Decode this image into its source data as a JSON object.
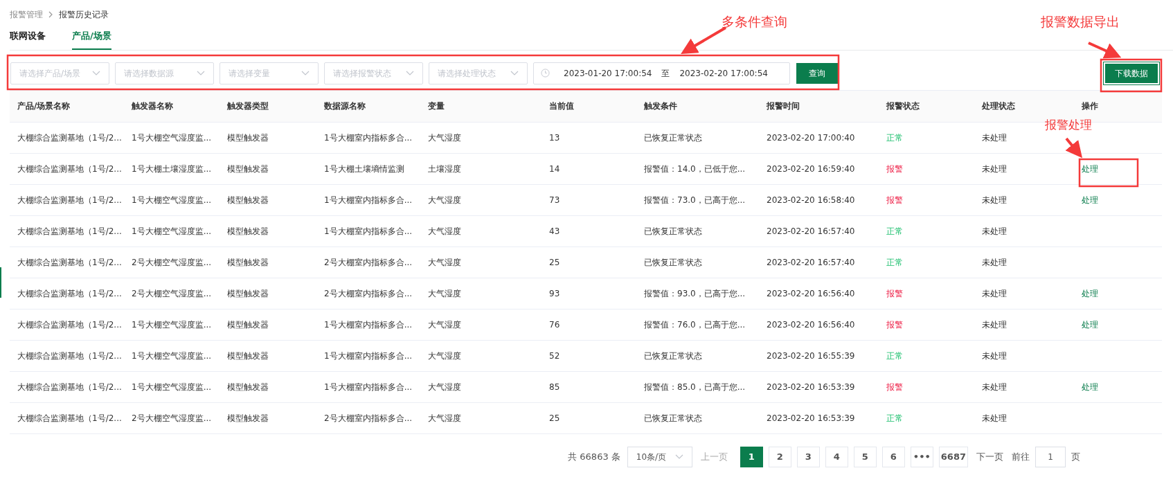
{
  "breadcrumb": [
    "报警管理",
    "报警历史记录"
  ],
  "tabs": [
    {
      "label": "联网设备",
      "selected": false
    },
    {
      "label": "产品/场景",
      "selected": true
    }
  ],
  "filters": {
    "selects": [
      "请选择产品/场景",
      "请选择数据源",
      "请选择变量",
      "请选择报警状态",
      "请选择处理状态"
    ],
    "date_start": "2023-01-20 17:00:54",
    "date_separator": "至",
    "date_end": "2023-02-20 17:00:54",
    "query_button": "查询"
  },
  "download_button": "下载数据",
  "table": {
    "columns": [
      "产品/场景名称",
      "触发器名称",
      "触发器类型",
      "数据源名称",
      "变量",
      "当前值",
      "触发条件",
      "报警时间",
      "报警状态",
      "处理状态",
      "操作"
    ],
    "rows": [
      {
        "cells": [
          "大棚综合监测基地（1号/2...",
          "1号大棚空气湿度监...",
          "模型触发器",
          "1号大棚室内指标多合...",
          "大气湿度",
          "13",
          "已恢复正常状态",
          "2023-02-20 17:00:40"
        ],
        "status": {
          "text": "正常",
          "kind": "normal"
        },
        "handling": "未处理"
      },
      {
        "cells": [
          "大棚综合监测基地（1号/2...",
          "1号大棚土壤湿度监...",
          "模型触发器",
          "1号大棚土壤墒情监测",
          "土壤湿度",
          "14",
          "报警值：14.0，已低于您...",
          "2023-02-20 16:59:40"
        ],
        "status": {
          "text": "报警",
          "kind": "alarm"
        },
        "handling": "未处理",
        "action": "处理"
      },
      {
        "cells": [
          "大棚综合监测基地（1号/2...",
          "1号大棚空气湿度监...",
          "模型触发器",
          "1号大棚室内指标多合...",
          "大气湿度",
          "73",
          "报警值：73.0，已高于您...",
          "2023-02-20 16:58:40"
        ],
        "status": {
          "text": "报警",
          "kind": "alarm"
        },
        "handling": "未处理",
        "action": "处理"
      },
      {
        "cells": [
          "大棚综合监测基地（1号/2...",
          "1号大棚空气湿度监...",
          "模型触发器",
          "1号大棚室内指标多合...",
          "大气湿度",
          "43",
          "已恢复正常状态",
          "2023-02-20 16:57:40"
        ],
        "status": {
          "text": "正常",
          "kind": "normal"
        },
        "handling": "未处理"
      },
      {
        "cells": [
          "大棚综合监测基地（1号/2...",
          "2号大棚空气湿度监...",
          "模型触发器",
          "2号大棚室内指标多合...",
          "大气湿度",
          "25",
          "已恢复正常状态",
          "2023-02-20 16:57:40"
        ],
        "status": {
          "text": "正常",
          "kind": "normal"
        },
        "handling": "未处理"
      },
      {
        "cells": [
          "大棚综合监测基地（1号/2...",
          "2号大棚空气湿度监...",
          "模型触发器",
          "2号大棚室内指标多合...",
          "大气湿度",
          "93",
          "报警值：93.0，已高于您...",
          "2023-02-20 16:56:40"
        ],
        "status": {
          "text": "报警",
          "kind": "alarm"
        },
        "handling": "未处理",
        "action": "处理"
      },
      {
        "cells": [
          "大棚综合监测基地（1号/2...",
          "1号大棚空气湿度监...",
          "模型触发器",
          "1号大棚室内指标多合...",
          "大气湿度",
          "76",
          "报警值：76.0，已高于您...",
          "2023-02-20 16:56:40"
        ],
        "status": {
          "text": "报警",
          "kind": "alarm"
        },
        "handling": "未处理",
        "action": "处理"
      },
      {
        "cells": [
          "大棚综合监测基地（1号/2...",
          "1号大棚空气湿度监...",
          "模型触发器",
          "1号大棚室内指标多合...",
          "大气湿度",
          "52",
          "已恢复正常状态",
          "2023-02-20 16:55:39"
        ],
        "status": {
          "text": "正常",
          "kind": "normal"
        },
        "handling": "未处理"
      },
      {
        "cells": [
          "大棚综合监测基地（1号/2...",
          "1号大棚空气湿度监...",
          "模型触发器",
          "1号大棚室内指标多合...",
          "大气湿度",
          "85",
          "报警值：85.0，已高于您...",
          "2023-02-20 16:53:39"
        ],
        "status": {
          "text": "报警",
          "kind": "alarm"
        },
        "handling": "未处理",
        "action": "处理"
      },
      {
        "cells": [
          "大棚综合监测基地（1号/2...",
          "2号大棚空气湿度监...",
          "模型触发器",
          "2号大棚室内指标多合...",
          "大气湿度",
          "25",
          "已恢复正常状态",
          "2023-02-20 16:53:39"
        ],
        "status": {
          "text": "正常",
          "kind": "normal"
        },
        "handling": "未处理"
      }
    ]
  },
  "pagination": {
    "total": "共 66863 条",
    "page_size": "10条/页",
    "prev": "上一页",
    "pages": [
      {
        "label": "1",
        "selected": true
      },
      {
        "label": "2",
        "selected": false
      },
      {
        "label": "3",
        "selected": false
      },
      {
        "label": "4",
        "selected": false
      },
      {
        "label": "5",
        "selected": false
      },
      {
        "label": "6",
        "selected": false
      },
      {
        "label": "•••",
        "selected": false
      },
      {
        "label": "6687",
        "selected": false
      }
    ],
    "next": "下一页",
    "goto_label": "前往",
    "goto_value": "1",
    "goto_suffix": "页"
  },
  "annotations": [
    "多条件查询",
    "报警数据导出",
    "报警处理"
  ]
}
